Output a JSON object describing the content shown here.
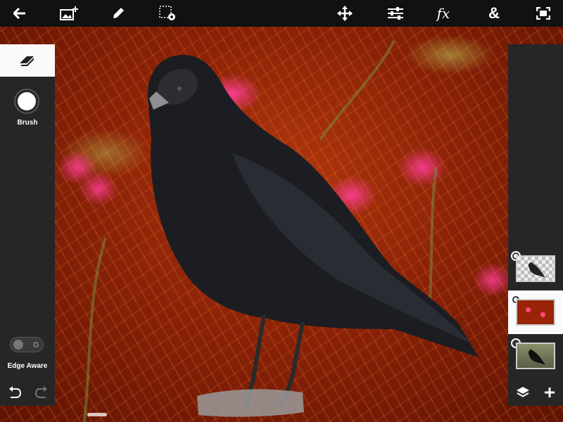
{
  "toolbar": {
    "back": "back-arrow-icon",
    "add_image": "add-image-icon",
    "draw": "pencil-icon",
    "selection_settings": "selection-settings-icon",
    "move": "move-arrows-icon",
    "adjustments": "sliders-icon",
    "effects_label": "fx",
    "text_label": "&",
    "fullscreen": "fullscreen-icon"
  },
  "left_panel": {
    "active_tool": "eraser-icon",
    "brush_label": "Brush",
    "edge_aware_label": "Edge Aware",
    "edge_aware_on": false,
    "undo": "undo-icon",
    "redo": "redo-icon"
  },
  "right_panel": {
    "layers": [
      {
        "name": "crow-cutout-layer",
        "selected": false,
        "radio_on": true
      },
      {
        "name": "red-flowers-layer",
        "selected": true,
        "radio_on": true
      },
      {
        "name": "original-photo-layer",
        "selected": false,
        "radio_on": false
      }
    ],
    "layers_button": "layers-stack-icon",
    "add_layer_button": "plus-icon"
  },
  "colors": {
    "toolbar_bg": "#111111",
    "panel_bg": "#262626",
    "active_tab_bg": "#fafafa",
    "canvas_red": "#a12c0b",
    "flower_pink": "#ff3c96"
  }
}
